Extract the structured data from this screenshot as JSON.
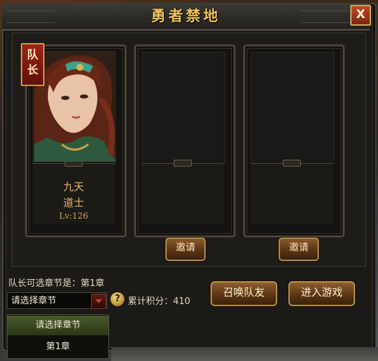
{
  "window": {
    "title": "勇者禁地",
    "close_label": "X"
  },
  "slots": [
    {
      "captain_badge": [
        "队",
        "长"
      ],
      "name": "九天",
      "class": "道士",
      "level": "Lv:126"
    },
    {
      "invite_label": "邀请"
    },
    {
      "invite_label": "邀请"
    }
  ],
  "footer": {
    "chapter_text": "队长可选章节是：第1章",
    "select_value": "请选择章节",
    "score_text": "累计积分：410",
    "summon_button": "召唤队友",
    "enter_button": "进入游戏",
    "help_icon": "?"
  },
  "dropdown": {
    "options": [
      "请选择章节",
      "第1章"
    ]
  },
  "colors": {
    "title": "#f0c35a",
    "gold_text": "#e6b860",
    "button_bg": "#5c3614",
    "badge_red": "#9e2418"
  },
  "icons": [
    "close-icon",
    "help-icon",
    "chevron-down-icon"
  ]
}
